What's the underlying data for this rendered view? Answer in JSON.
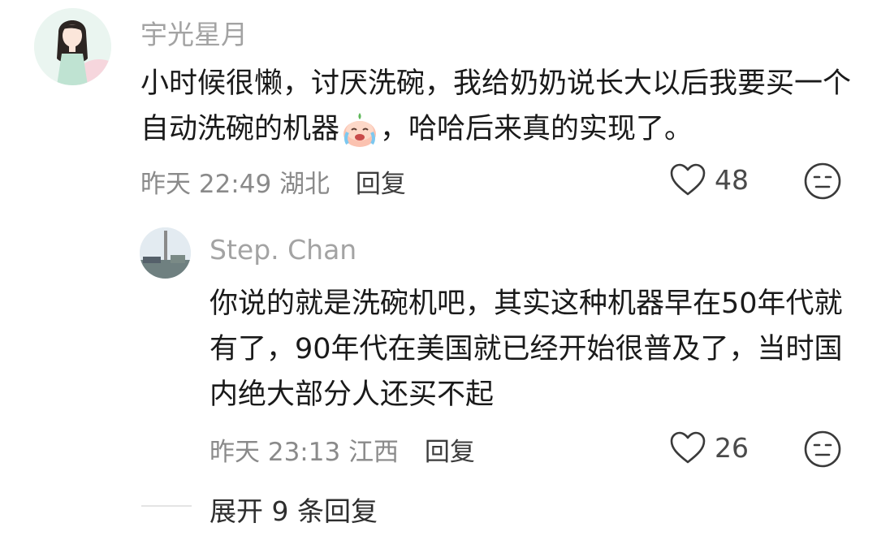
{
  "comments": [
    {
      "username": "宇光星月",
      "text_before_emoji": "小时候很懒，讨厌洗碗，我给奶奶说长大以后我要买一个自动洗碗的机器",
      "emoji": "crying-laughing-peach-emoji",
      "text_after_emoji": "，哈哈后来真的实现了。",
      "time": "昨天 22:49",
      "location": "湖北",
      "reply_label": "回复",
      "likes": "48"
    }
  ],
  "replies": [
    {
      "username": "Step. Chan",
      "text": "你说的就是洗碗机吧，其实这种机器早在50年代就有了，90年代在美国就已经开始很普及了，当时国内绝大部分人还买不起",
      "time": "昨天 23:13",
      "location": "江西",
      "reply_label": "回复",
      "likes": "26"
    }
  ],
  "expand_replies_label": "展开 9 条回复",
  "icons": {
    "like": "heart-outline-icon",
    "react": "neutral-face-icon"
  }
}
